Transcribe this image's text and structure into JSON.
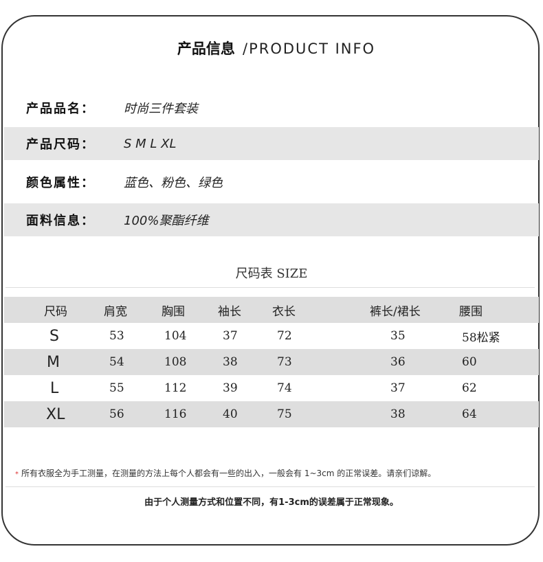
{
  "header": {
    "title_cn": "产品信息",
    "title_en": "/PRODUCT INFO"
  },
  "info": [
    {
      "label": "产品品名：",
      "value": "时尚三件套装"
    },
    {
      "label": "产品尺码：",
      "value": "S M L XL"
    },
    {
      "label": "颜色属性：",
      "value": "蓝色、粉色、绿色"
    },
    {
      "label": "面料信息：",
      "value": "100%聚酯纤维"
    }
  ],
  "size_table": {
    "title_cn": "尺码表",
    "title_en": "SIZE",
    "columns": [
      "尺码",
      "肩宽",
      "胸围",
      "袖长",
      "衣长",
      "裤长/裙长",
      "腰围"
    ],
    "rows": [
      [
        "S",
        "53",
        "104",
        "37",
        "72",
        "35",
        "58松紧"
      ],
      [
        "M",
        "54",
        "108",
        "38",
        "73",
        "36",
        "60"
      ],
      [
        "L",
        "55",
        "112",
        "39",
        "74",
        "37",
        "62"
      ],
      [
        "XL",
        "56",
        "116",
        "40",
        "75",
        "38",
        "64"
      ]
    ]
  },
  "note": {
    "star": "*",
    "text": "所有衣服全为手工测量，在测量的方法上每个人都会有一些的出入，一般会有 1~3cm 的正常误差。请亲们谅解。"
  },
  "footer": "由于个人测量方式和位置不同，有1-3cm的误差属于正常现象。"
}
